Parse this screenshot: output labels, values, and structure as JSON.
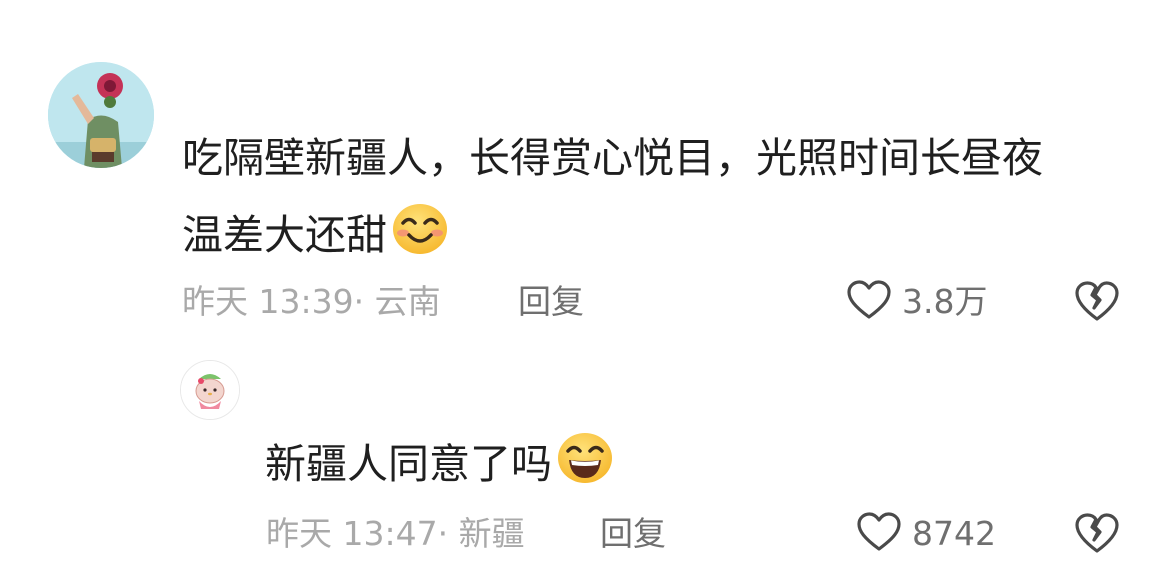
{
  "comment": {
    "text_line1": "吃隔壁新疆人，长得赏心悦目，光照时间长昼夜",
    "text_line2": "温差大还甜",
    "time": "昨天 13:39",
    "location": "云南",
    "reply_label": "回复",
    "likes": "3.8万",
    "emoji": "smiling-face-with-smiling-eyes"
  },
  "reply": {
    "text": "新疆人同意了吗",
    "time": "昨天 13:47",
    "location": "新疆",
    "reply_label": "回复",
    "likes": "8742",
    "emoji": "grinning-face-with-smiling-eyes"
  },
  "colors": {
    "text": "#1f1f1f",
    "meta": "#a9a9a9",
    "action": "#6f6f6f",
    "emoji_yellow": "#ffc83d"
  }
}
